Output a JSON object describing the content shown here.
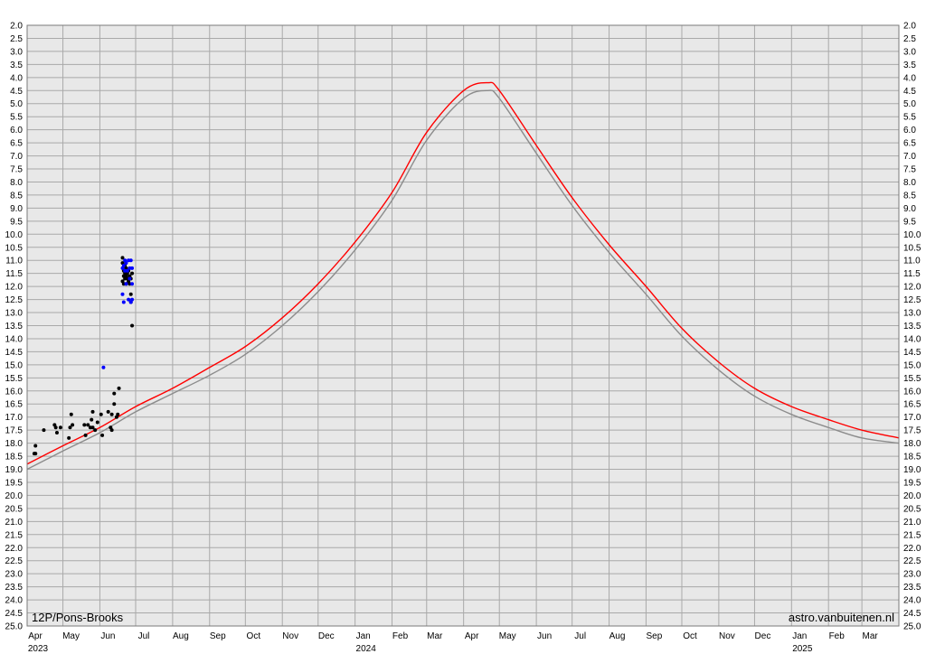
{
  "chart_data": {
    "type": "scatter",
    "title": "",
    "object_label": "12P/Pons-Brooks",
    "credit_label": "astro.vanbuitenen.nl",
    "xlabel": "",
    "ylabel": "",
    "y_axis_inverted": true,
    "ylim": [
      2.0,
      25.0
    ],
    "y_step": 0.5,
    "x_start": "2023-04-01",
    "x_end": "2025-04-01",
    "grid": true,
    "months": [
      {
        "label": "Apr",
        "date": "2023-04-01",
        "year": "2023"
      },
      {
        "label": "May",
        "date": "2023-05-01"
      },
      {
        "label": "Jun",
        "date": "2023-06-01"
      },
      {
        "label": "Jul",
        "date": "2023-07-01"
      },
      {
        "label": "Aug",
        "date": "2023-08-01"
      },
      {
        "label": "Sep",
        "date": "2023-09-01"
      },
      {
        "label": "Oct",
        "date": "2023-10-01"
      },
      {
        "label": "Nov",
        "date": "2023-11-01"
      },
      {
        "label": "Dec",
        "date": "2023-12-01"
      },
      {
        "label": "Jan",
        "date": "2024-01-01",
        "year": "2024"
      },
      {
        "label": "Feb",
        "date": "2024-02-01"
      },
      {
        "label": "Mar",
        "date": "2024-03-01"
      },
      {
        "label": "Apr",
        "date": "2024-04-01"
      },
      {
        "label": "May",
        "date": "2024-05-01"
      },
      {
        "label": "Jun",
        "date": "2024-06-01"
      },
      {
        "label": "Jul",
        "date": "2024-07-01"
      },
      {
        "label": "Aug",
        "date": "2024-08-01"
      },
      {
        "label": "Sep",
        "date": "2024-09-01"
      },
      {
        "label": "Oct",
        "date": "2024-10-01"
      },
      {
        "label": "Nov",
        "date": "2024-11-01"
      },
      {
        "label": "Dec",
        "date": "2024-12-01"
      },
      {
        "label": "Jan",
        "date": "2025-01-01",
        "year": "2025"
      },
      {
        "label": "Feb",
        "date": "2025-02-01"
      },
      {
        "label": "Mar",
        "date": "2025-03-01"
      }
    ],
    "series": [
      {
        "kind": "curve",
        "color": "#ff0000",
        "points": [
          [
            "2023-04-01",
            18.8
          ],
          [
            "2023-05-01",
            18.1
          ],
          [
            "2023-06-01",
            17.4
          ],
          [
            "2023-07-01",
            16.6
          ],
          [
            "2023-08-01",
            15.9
          ],
          [
            "2023-09-01",
            15.1
          ],
          [
            "2023-10-01",
            14.3
          ],
          [
            "2023-11-01",
            13.2
          ],
          [
            "2023-12-01",
            11.9
          ],
          [
            "2024-01-01",
            10.3
          ],
          [
            "2024-02-01",
            8.4
          ],
          [
            "2024-03-01",
            6.1
          ],
          [
            "2024-04-01",
            4.5
          ],
          [
            "2024-04-21",
            4.2
          ],
          [
            "2024-05-01",
            4.5
          ],
          [
            "2024-06-01",
            6.6
          ],
          [
            "2024-07-01",
            8.6
          ],
          [
            "2024-08-01",
            10.4
          ],
          [
            "2024-09-01",
            12.0
          ],
          [
            "2024-10-01",
            13.6
          ],
          [
            "2024-11-01",
            14.9
          ],
          [
            "2024-12-01",
            15.9
          ],
          [
            "2025-01-01",
            16.6
          ],
          [
            "2025-02-01",
            17.1
          ],
          [
            "2025-03-01",
            17.5
          ],
          [
            "2025-04-01",
            17.8
          ]
        ]
      },
      {
        "kind": "curve",
        "color": "#8c8c8c",
        "points": [
          [
            "2023-04-01",
            19.0
          ],
          [
            "2023-05-01",
            18.3
          ],
          [
            "2023-06-01",
            17.6
          ],
          [
            "2023-07-01",
            16.8
          ],
          [
            "2023-08-01",
            16.1
          ],
          [
            "2023-09-01",
            15.4
          ],
          [
            "2023-10-01",
            14.6
          ],
          [
            "2023-11-01",
            13.5
          ],
          [
            "2023-12-01",
            12.2
          ],
          [
            "2024-01-01",
            10.6
          ],
          [
            "2024-02-01",
            8.7
          ],
          [
            "2024-03-01",
            6.4
          ],
          [
            "2024-04-01",
            4.8
          ],
          [
            "2024-04-21",
            4.5
          ],
          [
            "2024-05-01",
            4.8
          ],
          [
            "2024-06-01",
            6.9
          ],
          [
            "2024-07-01",
            8.9
          ],
          [
            "2024-08-01",
            10.7
          ],
          [
            "2024-09-01",
            12.3
          ],
          [
            "2024-10-01",
            13.9
          ],
          [
            "2024-11-01",
            15.2
          ],
          [
            "2024-12-01",
            16.2
          ],
          [
            "2025-01-01",
            16.9
          ],
          [
            "2025-02-01",
            17.4
          ],
          [
            "2025-03-01",
            17.8
          ],
          [
            "2025-04-01",
            18.0
          ]
        ]
      },
      {
        "kind": "points",
        "color": "#000000",
        "points": [
          [
            "2023-04-07",
            18.4
          ],
          [
            "2023-04-08",
            18.4
          ],
          [
            "2023-04-08",
            18.1
          ],
          [
            "2023-04-15",
            17.5
          ],
          [
            "2023-04-24",
            17.3
          ],
          [
            "2023-04-25",
            17.4
          ],
          [
            "2023-04-26",
            17.6
          ],
          [
            "2023-04-29",
            17.4
          ],
          [
            "2023-05-06",
            17.8
          ],
          [
            "2023-05-07",
            17.4
          ],
          [
            "2023-05-08",
            16.9
          ],
          [
            "2023-05-09",
            17.3
          ],
          [
            "2023-05-19",
            17.3
          ],
          [
            "2023-05-20",
            17.7
          ],
          [
            "2023-05-22",
            17.3
          ],
          [
            "2023-05-24",
            17.4
          ],
          [
            "2023-05-25",
            17.1
          ],
          [
            "2023-05-26",
            17.4
          ],
          [
            "2023-05-26",
            16.8
          ],
          [
            "2023-05-28",
            17.5
          ],
          [
            "2023-05-30",
            17.2
          ],
          [
            "2023-06-02",
            16.9
          ],
          [
            "2023-06-03",
            17.7
          ],
          [
            "2023-06-08",
            16.8
          ],
          [
            "2023-06-10",
            17.4
          ],
          [
            "2023-06-11",
            17.5
          ],
          [
            "2023-06-11",
            16.9
          ],
          [
            "2023-06-13",
            16.5
          ],
          [
            "2023-06-13",
            16.1
          ],
          [
            "2023-06-15",
            17.0
          ],
          [
            "2023-06-16",
            16.9
          ],
          [
            "2023-06-17",
            15.9
          ],
          [
            "2023-06-20",
            10.9
          ],
          [
            "2023-06-20",
            11.1
          ],
          [
            "2023-06-20",
            11.8
          ],
          [
            "2023-06-21",
            11.4
          ],
          [
            "2023-06-21",
            11.6
          ],
          [
            "2023-06-21",
            11.9
          ],
          [
            "2023-06-22",
            11.2
          ],
          [
            "2023-06-22",
            11.5
          ],
          [
            "2023-06-22",
            11.7
          ],
          [
            "2023-06-23",
            11.3
          ],
          [
            "2023-06-23",
            11.6
          ],
          [
            "2023-06-23",
            11.9
          ],
          [
            "2023-06-24",
            11.5
          ],
          [
            "2023-06-24",
            11.7
          ],
          [
            "2023-06-25",
            11.4
          ],
          [
            "2023-06-25",
            11.8
          ],
          [
            "2023-06-26",
            11.6
          ],
          [
            "2023-06-26",
            11.9
          ],
          [
            "2023-06-27",
            11.7
          ],
          [
            "2023-06-27",
            12.3
          ],
          [
            "2023-06-27",
            12.6
          ],
          [
            "2023-06-28",
            11.5
          ],
          [
            "2023-06-28",
            13.5
          ]
        ]
      },
      {
        "kind": "points",
        "color": "#0000ff",
        "points": [
          [
            "2023-06-04",
            15.1
          ],
          [
            "2023-06-20",
            11.3
          ],
          [
            "2023-06-20",
            12.3
          ],
          [
            "2023-06-21",
            12.6
          ],
          [
            "2023-06-21",
            11.2
          ],
          [
            "2023-06-22",
            11.0
          ],
          [
            "2023-06-22",
            11.4
          ],
          [
            "2023-06-23",
            11.9
          ],
          [
            "2023-06-23",
            11.1
          ],
          [
            "2023-06-24",
            11.4
          ],
          [
            "2023-06-25",
            11.0
          ],
          [
            "2023-06-25",
            12.5
          ],
          [
            "2023-06-26",
            11.3
          ],
          [
            "2023-06-26",
            11.7
          ],
          [
            "2023-06-27",
            11.0
          ],
          [
            "2023-06-27",
            12.6
          ],
          [
            "2023-06-28",
            11.3
          ],
          [
            "2023-06-28",
            11.9
          ],
          [
            "2023-06-28",
            12.5
          ]
        ]
      }
    ]
  }
}
